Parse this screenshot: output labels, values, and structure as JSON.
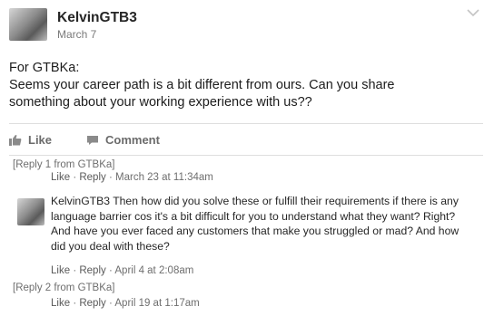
{
  "post": {
    "author": "KelvinGTB3",
    "date": "March 7",
    "lines": [
      "For GTBKa:",
      "Seems your career path is a bit different from ours. Can you share",
      "something about your working experience with us??"
    ]
  },
  "actions": {
    "like": "Like",
    "comment": "Comment"
  },
  "comments": [
    {
      "note": "[Reply 1 from GTBKa]",
      "like": "Like",
      "reply": "Reply",
      "sep": "·",
      "time": "March 23 at 11:34am"
    },
    {
      "author": "KelvinGTB3",
      "text": "Then how did you solve these or fulfill their requirements if there is any language barrier cos it's a bit difficult for you to understand what they want? Right? And have you ever faced any customers that make you struggled or mad? And how did you deal with these?",
      "like": "Like",
      "reply": "Reply",
      "sep": "·",
      "time": "April 4 at 2:08am"
    },
    {
      "note": "[Reply 2 from GTBKa]",
      "like": "Like",
      "reply": "Reply",
      "sep": "·",
      "time": "April 19 at 1:17am"
    }
  ],
  "icons": {
    "menu": "chevron-down-icon",
    "like": "thumbs-up-icon",
    "comment": "comment-bubble-icon"
  }
}
